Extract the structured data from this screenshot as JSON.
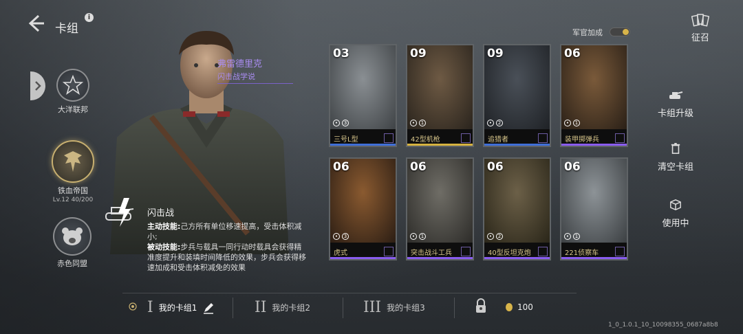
{
  "header": {
    "title": "卡组",
    "info_icon": "i"
  },
  "factions": [
    {
      "label": "大洋联邦",
      "active": false
    },
    {
      "label": "铁血帝国",
      "active": true,
      "level": "Lv.12  40/200"
    },
    {
      "label": "赤色同盟",
      "active": false
    }
  ],
  "commander": {
    "name": "弗雷德里克",
    "doctrine": "闪击战学说",
    "skill_name": "闪击战",
    "active_label": "主动技能:",
    "active_text": "己方所有单位移速提高，受击体积减小;",
    "passive_label": "被动技能:",
    "passive_text": "步兵与载具一同行动时载具会获得精准度提升和装填时间降低的效果，步兵会获得移速加成和受击体积减免的效果"
  },
  "officer_bonus": {
    "label": "军官加成",
    "on": true
  },
  "cards": [
    {
      "cost": "03",
      "name": "三号L型",
      "m1": "3",
      "color": "#3f6fd8"
    },
    {
      "cost": "09",
      "name": "42型机枪",
      "m1": "1",
      "color": "#d7b340"
    },
    {
      "cost": "09",
      "name": "追猎者",
      "m1": "2",
      "color": "#3f6fd8"
    },
    {
      "cost": "06",
      "name": "装甲掷弹兵",
      "m1": "1",
      "color": "#8a5cf0"
    },
    {
      "cost": "06",
      "name": "虎式",
      "m1": "3",
      "color": "#8a5cf0"
    },
    {
      "cost": "06",
      "name": "突击战斗工兵",
      "m1": "1",
      "color": "#8a5cf0"
    },
    {
      "cost": "06",
      "name": "40型反坦克炮",
      "m1": "2",
      "color": "#8a5cf0"
    },
    {
      "cost": "06",
      "name": "221侦察车",
      "m1": "1",
      "color": "#8a5cf0"
    }
  ],
  "right_menu": {
    "recruit": "征召",
    "upgrade": "卡组升级",
    "clear": "清空卡组",
    "in_use": "使用中"
  },
  "deck_tabs": [
    {
      "roman": "I",
      "label": "我的卡组1"
    },
    {
      "roman": "II",
      "label": "我的卡组2"
    },
    {
      "roman": "III",
      "label": "我的卡组3"
    }
  ],
  "currency": {
    "value": "100"
  },
  "version": "1_0_1.0.1_10_10098355_0687a8b8"
}
